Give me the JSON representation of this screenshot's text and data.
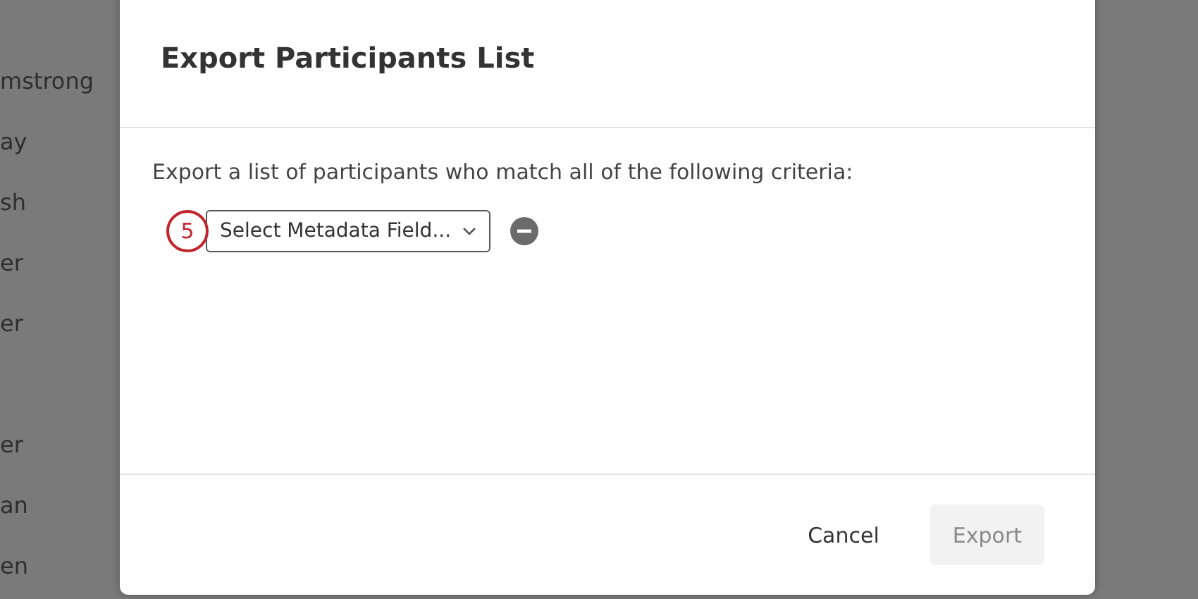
{
  "background_list": [
    {
      "items": [
        "mstrong",
        "ay",
        "sh",
        "er",
        "er"
      ]
    },
    {
      "items": [
        "er",
        "an",
        "en"
      ]
    }
  ],
  "dialog": {
    "title": "Export Participants List",
    "description": "Export a list of participants who match all of the following criteria:",
    "step_badge": "5",
    "criteria": [
      {
        "field": {
          "placeholder": "Select Metadata Field..."
        }
      }
    ],
    "buttons": [
      {
        "label": "Cancel",
        "kind": "text",
        "disabled": false
      },
      {
        "label": "Export",
        "kind": "primary",
        "disabled": true
      }
    ]
  }
}
